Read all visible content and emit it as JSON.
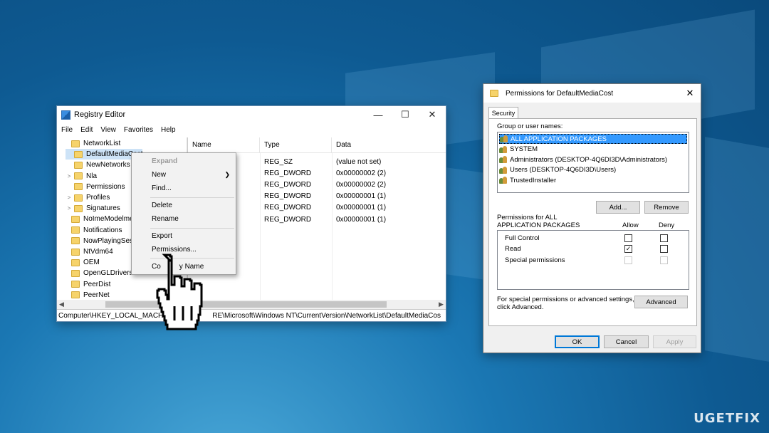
{
  "watermark": "UGETFIX",
  "registry": {
    "title": "Registry Editor",
    "menu": [
      "File",
      "Edit",
      "View",
      "Favorites",
      "Help"
    ],
    "tree": [
      {
        "label": "NetworkList",
        "indent": 0,
        "twisty": ""
      },
      {
        "label": "DefaultMediaCost",
        "indent": 1,
        "twisty": "",
        "selected": true
      },
      {
        "label": "NewNetworks",
        "indent": 1,
        "twisty": ""
      },
      {
        "label": "Nla",
        "indent": 1,
        "twisty": ">"
      },
      {
        "label": "Permissions",
        "indent": 1,
        "twisty": ""
      },
      {
        "label": "Profiles",
        "indent": 1,
        "twisty": ">"
      },
      {
        "label": "Signatures",
        "indent": 1,
        "twisty": ">"
      },
      {
        "label": "NoImeModelmes",
        "indent": 0,
        "twisty": ""
      },
      {
        "label": "Notifications",
        "indent": 0,
        "twisty": ""
      },
      {
        "label": "NowPlayingSessic",
        "indent": 0,
        "twisty": ""
      },
      {
        "label": "NtVdm64",
        "indent": 0,
        "twisty": ""
      },
      {
        "label": "OEM",
        "indent": 0,
        "twisty": ""
      },
      {
        "label": "OpenGLDrivers",
        "indent": 0,
        "twisty": ""
      },
      {
        "label": "PeerDist",
        "indent": 0,
        "twisty": ""
      },
      {
        "label": "PeerNet",
        "indent": 0,
        "twisty": ""
      }
    ],
    "columns": {
      "name": "Name",
      "type": "Type",
      "data": "Data"
    },
    "rows": [
      {
        "type": "REG_SZ",
        "data": "(value not set)"
      },
      {
        "type": "REG_DWORD",
        "data": "0x00000002 (2)"
      },
      {
        "type": "REG_DWORD",
        "data": "0x00000002 (2)"
      },
      {
        "type": "REG_DWORD",
        "data": "0x00000001 (1)"
      },
      {
        "type": "REG_DWORD",
        "data": "0x00000001 (1)"
      },
      {
        "type": "REG_DWORD",
        "data": "0x00000001 (1)"
      }
    ],
    "status_left": "Computer\\HKEY_LOCAL_MACH",
    "status_right": "RE\\Microsoft\\Windows NT\\CurrentVersion\\NetworkList\\DefaultMediaCos"
  },
  "context_menu": {
    "expand": "Expand",
    "new": "New",
    "find": "Find...",
    "delete": "Delete",
    "rename": "Rename",
    "export": "Export",
    "permissions": "Permissions...",
    "copy_name_left": "Co",
    "copy_name_right": "y Name"
  },
  "permissions": {
    "title": "Permissions for DefaultMediaCost",
    "tab": "Security",
    "group_label": "Group or user names:",
    "users": [
      "ALL APPLICATION PACKAGES",
      "SYSTEM",
      "Administrators (DESKTOP-4Q6DI3D\\Administrators)",
      "Users (DESKTOP-4Q6DI3D\\Users)",
      "TrustedInstaller"
    ],
    "add": "Add...",
    "remove": "Remove",
    "perm_label_1": "Permissions for ALL",
    "perm_label_2": "APPLICATION PACKAGES",
    "allow": "Allow",
    "deny": "Deny",
    "perm_rows": [
      {
        "name": "Full Control",
        "allow": false,
        "deny": false,
        "disabled": false
      },
      {
        "name": "Read",
        "allow": true,
        "deny": false,
        "disabled": false
      },
      {
        "name": "Special permissions",
        "allow": false,
        "deny": false,
        "disabled": true
      }
    ],
    "special_text_1": "For special permissions or advanced settings,",
    "special_text_2": "click Advanced.",
    "advanced": "Advanced",
    "ok": "OK",
    "cancel": "Cancel",
    "apply": "Apply"
  }
}
